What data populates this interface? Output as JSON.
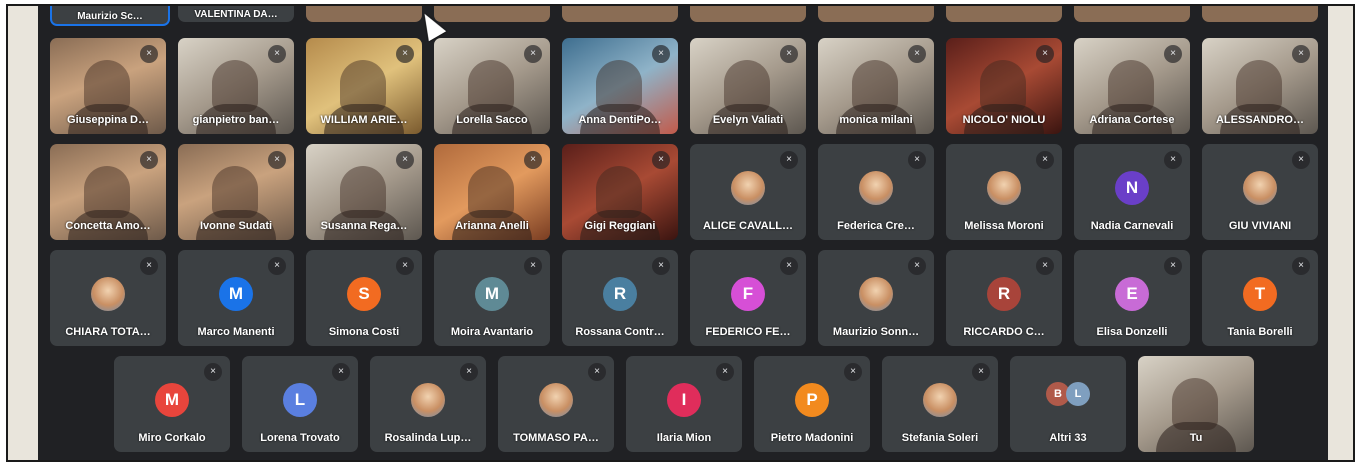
{
  "meeting": {
    "top_row": [
      "Maurizio Sc…",
      "VALENTINA DA…",
      "",
      "",
      "",
      "",
      "",
      "",
      "",
      "",
      ""
    ],
    "row1": [
      {
        "name": "Giuseppina D…",
        "type": "cam",
        "variant": "c1"
      },
      {
        "name": "gianpietro ban…",
        "type": "cam",
        "variant": "c2"
      },
      {
        "name": "WILLIAM ARIE…",
        "type": "cam",
        "variant": "c3"
      },
      {
        "name": "Lorella Sacco",
        "type": "cam",
        "variant": "c2"
      },
      {
        "name": "Anna DentiPo…",
        "type": "cam",
        "variant": "c4"
      },
      {
        "name": "Evelyn Valiati",
        "type": "cam",
        "variant": "c2"
      },
      {
        "name": "monica milani",
        "type": "cam",
        "variant": "c2"
      },
      {
        "name": "NICOLO' NIOLU",
        "type": "cam",
        "variant": "c6"
      },
      {
        "name": "Adriana Cortese",
        "type": "cam",
        "variant": "c2"
      },
      {
        "name": "ALESSANDRO…",
        "type": "cam",
        "variant": "c2"
      }
    ],
    "row2": [
      {
        "name": "Concetta Amo…",
        "type": "cam",
        "variant": "c1"
      },
      {
        "name": "Ivonne Sudati",
        "type": "cam",
        "variant": "c1"
      },
      {
        "name": "Susanna Rega…",
        "type": "cam",
        "variant": "c2"
      },
      {
        "name": "Arianna Anelli",
        "type": "cam",
        "variant": "c5"
      },
      {
        "name": "Gigi Reggiani",
        "type": "cam",
        "variant": "c6"
      },
      {
        "name": "ALICE CAVALL…",
        "type": "avatar",
        "initial": "",
        "color": "#5b8fd6",
        "pic": true
      },
      {
        "name": "Federica Cre…",
        "type": "avatar",
        "initial": "",
        "color": "#e0763a",
        "pic": true
      },
      {
        "name": "Melissa Moroni",
        "type": "avatar",
        "initial": "",
        "color": "#8fc7e8",
        "pic": true
      },
      {
        "name": "Nadia Carnevali",
        "type": "avatar",
        "initial": "N",
        "color": "#6a3fc8",
        "pic": false
      },
      {
        "name": "GIU VIVIANI",
        "type": "avatar",
        "initial": "",
        "color": "#d9a38a",
        "pic": true
      }
    ],
    "row3": [
      {
        "name": "CHIARA TOTA…",
        "type": "avatar",
        "initial": "",
        "color": "#d8b89a",
        "pic": true
      },
      {
        "name": "Marco Manenti",
        "type": "avatar",
        "initial": "M",
        "color": "#1a73e8",
        "pic": false
      },
      {
        "name": "Simona Costi",
        "type": "avatar",
        "initial": "S",
        "color": "#f26b21",
        "pic": false
      },
      {
        "name": "Moira Avantario",
        "type": "avatar",
        "initial": "M",
        "color": "#5f8a95",
        "pic": false
      },
      {
        "name": "Rossana Contr…",
        "type": "avatar",
        "initial": "R",
        "color": "#4a7fa0",
        "pic": false
      },
      {
        "name": "FEDERICO FE…",
        "type": "avatar",
        "initial": "F",
        "color": "#d64fd6",
        "pic": false
      },
      {
        "name": "Maurizio Sonn…",
        "type": "avatar",
        "initial": "",
        "color": "#c9c2b8",
        "pic": true
      },
      {
        "name": "RICCARDO C…",
        "type": "avatar",
        "initial": "R",
        "color": "#a8443a",
        "pic": false
      },
      {
        "name": "Elisa Donzelli",
        "type": "avatar",
        "initial": "E",
        "color": "#c86bd6",
        "pic": false
      },
      {
        "name": "Tania Borelli",
        "type": "avatar",
        "initial": "T",
        "color": "#f26b21",
        "pic": false
      }
    ],
    "row4": [
      {
        "name": "Miro Corkalo",
        "type": "avatar",
        "initial": "M",
        "color": "#e8453c",
        "pic": false
      },
      {
        "name": "Lorena Trovato",
        "type": "avatar",
        "initial": "L",
        "color": "#5a7fe0",
        "pic": false
      },
      {
        "name": "Rosalinda Lup…",
        "type": "avatar",
        "initial": "",
        "color": "#7fb8c8",
        "pic": true
      },
      {
        "name": "TOMMASO PA…",
        "type": "avatar",
        "initial": "",
        "color": "#e8c49a",
        "pic": true
      },
      {
        "name": "Ilaria Mion",
        "type": "avatar",
        "initial": "I",
        "color": "#e02d5b",
        "pic": false
      },
      {
        "name": "Pietro Madonini",
        "type": "avatar",
        "initial": "P",
        "color": "#f28a1e",
        "pic": false
      },
      {
        "name": "Stefania Soleri",
        "type": "avatar",
        "initial": "",
        "color": "#d46a3a",
        "pic": true
      },
      {
        "name": "Altri 33",
        "type": "more",
        "dots": [
          {
            "initial": "B",
            "color": "#b05a4a"
          },
          {
            "initial": "L",
            "color": "#7f9fbf"
          }
        ]
      },
      {
        "name": "Tu",
        "type": "cam",
        "variant": "c2"
      }
    ]
  }
}
